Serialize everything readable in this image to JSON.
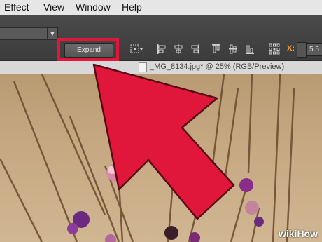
{
  "menubar": {
    "items": [
      "Effect",
      "View",
      "Window",
      "Help"
    ]
  },
  "toolbar": {
    "expand_label": "Expand",
    "x_label": "X:",
    "x_value": "5.5"
  },
  "document": {
    "title": "_MG_8134.jpg* @ 25% (RGB/Preview)"
  },
  "watermark": "wikiHow",
  "colors": {
    "highlight": "#e0163a",
    "arrow": "#e0163a",
    "menubar": "#e6e6e6",
    "toolbar": "#424242"
  }
}
